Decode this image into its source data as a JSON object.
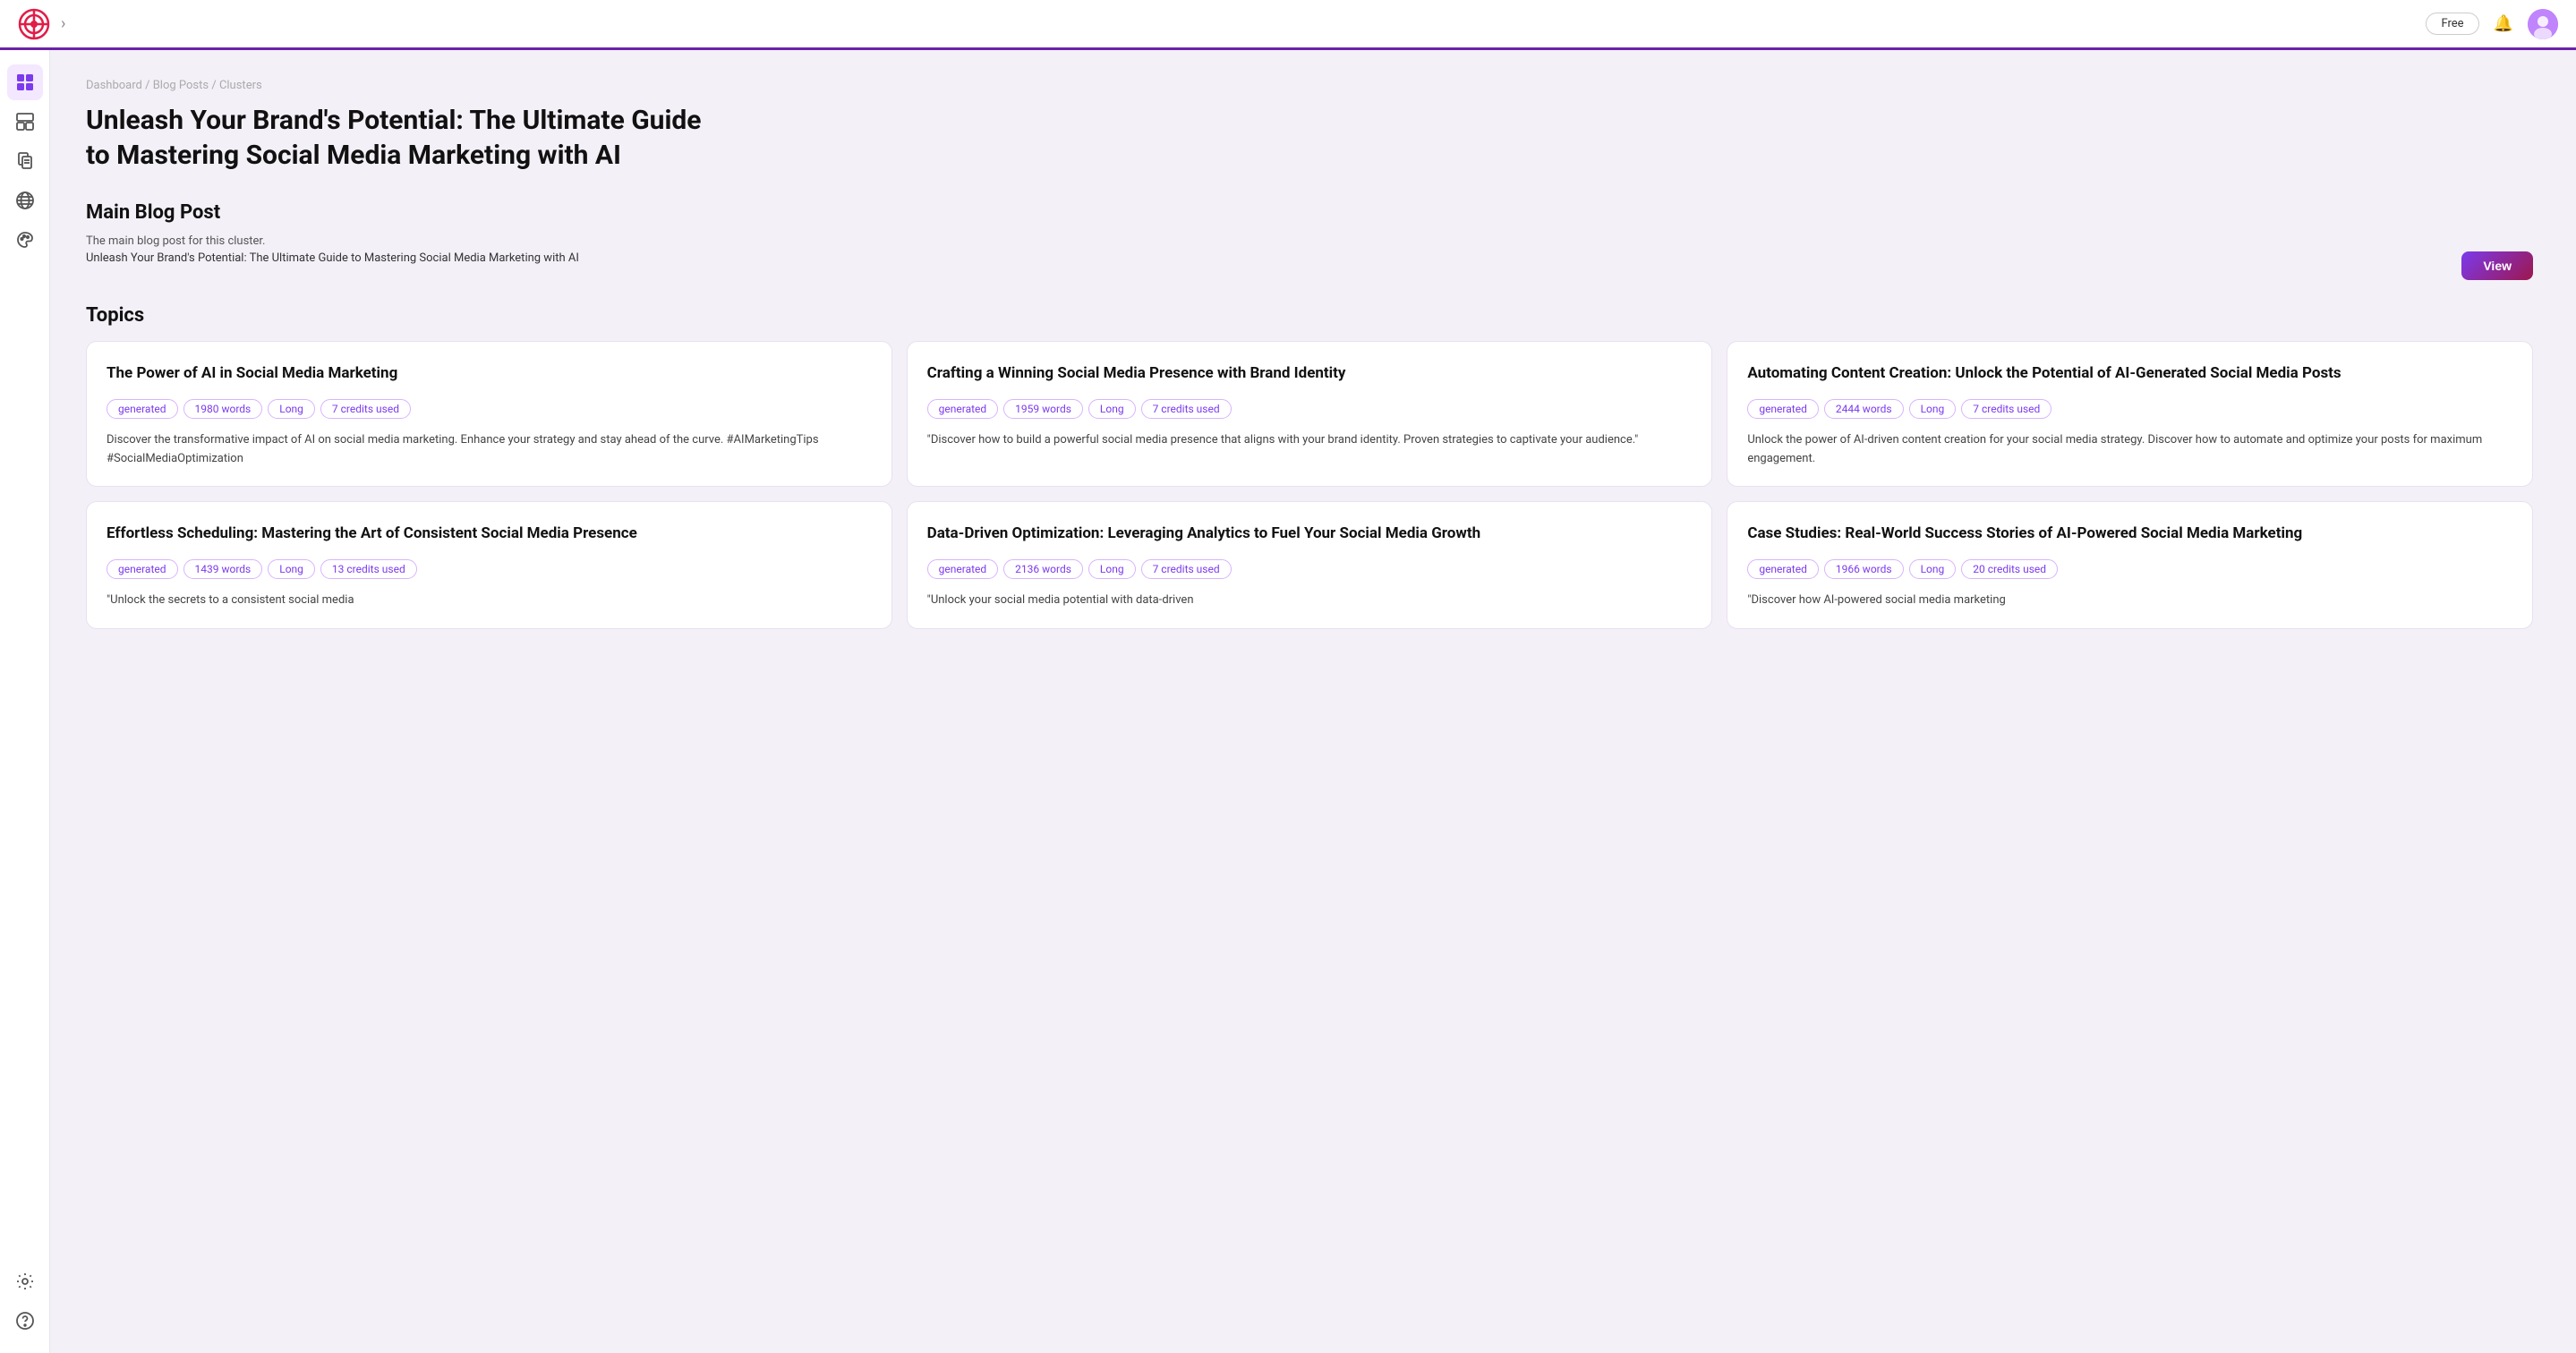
{
  "topbar": {
    "chevron": "›",
    "free_label": "Free",
    "bell_unicode": "🔔"
  },
  "breadcrumb": {
    "parts": [
      "Dashboard",
      "Blog Posts",
      "Clusters"
    ]
  },
  "page_title": "Unleash Your Brand's Potential: The Ultimate Guide to Mastering Social Media Marketing with AI",
  "main_blog_post": {
    "section_label": "Main Blog Post",
    "subtitle": "The main blog post for this cluster.",
    "link_text": "Unleash Your Brand's Potential: The Ultimate Guide to Mastering Social Media Marketing with AI",
    "view_button": "View"
  },
  "topics": {
    "heading": "Topics",
    "cards": [
      {
        "id": 1,
        "title": "The Power of AI in Social Media Marketing",
        "tags": [
          "generated",
          "1980 words",
          "Long",
          "7 credits used"
        ],
        "description": "Discover the transformative impact of AI on social media marketing. Enhance your strategy and stay ahead of the curve. #AIMarketingTips #SocialMediaOptimization"
      },
      {
        "id": 2,
        "title": "Crafting a Winning Social Media Presence with Brand Identity",
        "tags": [
          "generated",
          "1959 words",
          "Long",
          "7 credits used"
        ],
        "description": "\"Discover how to build a powerful social media presence that aligns with your brand identity. Proven strategies to captivate your audience.\""
      },
      {
        "id": 3,
        "title": "Automating Content Creation: Unlock the Potential of AI-Generated Social Media Posts",
        "tags": [
          "generated",
          "2444 words",
          "Long",
          "7 credits used"
        ],
        "description": "Unlock the power of AI-driven content creation for your social media strategy. Discover how to automate and optimize your posts for maximum engagement."
      },
      {
        "id": 4,
        "title": "Effortless Scheduling: Mastering the Art of Consistent Social Media Presence",
        "tags": [
          "generated",
          "1439 words",
          "Long",
          "13 credits used"
        ],
        "description": "\"Unlock the secrets to a consistent social media"
      },
      {
        "id": 5,
        "title": "Data-Driven Optimization: Leveraging Analytics to Fuel Your Social Media Growth",
        "tags": [
          "generated",
          "2136 words",
          "Long",
          "7 credits used"
        ],
        "description": "\"Unlock your social media potential with data-driven"
      },
      {
        "id": 6,
        "title": "Case Studies: Real-World Success Stories of AI-Powered Social Media Marketing",
        "tags": [
          "generated",
          "1966 words",
          "Long",
          "20 credits used"
        ],
        "description": "\"Discover how AI-powered social media marketing"
      }
    ]
  },
  "sidebar": {
    "items": [
      {
        "id": "dashboard",
        "icon": "⊞",
        "label": "Dashboard"
      },
      {
        "id": "layouts",
        "icon": "⊟",
        "label": "Layouts"
      },
      {
        "id": "documents",
        "icon": "⧉",
        "label": "Documents"
      },
      {
        "id": "globe",
        "icon": "◉",
        "label": "Globe"
      },
      {
        "id": "palette",
        "icon": "✦",
        "label": "Palette"
      }
    ],
    "bottom_items": [
      {
        "id": "settings",
        "icon": "⚙",
        "label": "Settings"
      },
      {
        "id": "help",
        "icon": "⑆",
        "label": "Help"
      }
    ]
  }
}
